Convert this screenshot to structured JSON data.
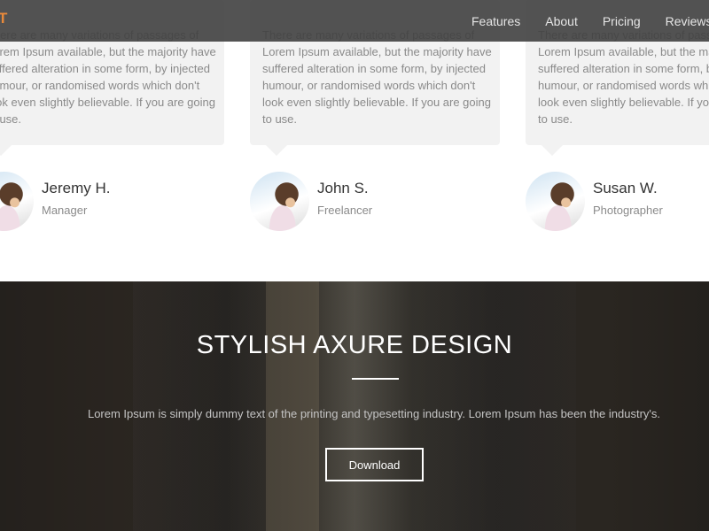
{
  "brand": {
    "logo_text": "T",
    "accent_color": "#e8893a"
  },
  "nav": {
    "links": [
      {
        "label": "Features"
      },
      {
        "label": "About"
      },
      {
        "label": "Pricing"
      },
      {
        "label": "Reviews"
      }
    ]
  },
  "testimonials": [
    {
      "quote": "There are many variations of passages of Lorem Ipsum available, but the majority have suffered alteration in some form, by injected humour, or randomised words which don't look even slightly believable. If you are going to use.",
      "name": "Jeremy H.",
      "role": "Manager"
    },
    {
      "quote": "There are many variations of passages of Lorem Ipsum available, but the majority have suffered alteration in some form, by injected humour, or randomised words which don't look even slightly believable. If you are going to use.",
      "name": "John S.",
      "role": "Freelancer"
    },
    {
      "quote": "There are many variations of passages of Lorem Ipsum available, but the majority have suffered alteration in some form, by injected humour, or randomised words which don't look even slightly believable. If you are going to use.",
      "name": "Susan W.",
      "role": "Photographer"
    }
  ],
  "hero": {
    "title": "STYLISH AXURE DESIGN",
    "text": "Lorem Ipsum is simply dummy text of the printing and typesetting industry. Lorem Ipsum has been the industry's.",
    "button_label": "Download"
  }
}
